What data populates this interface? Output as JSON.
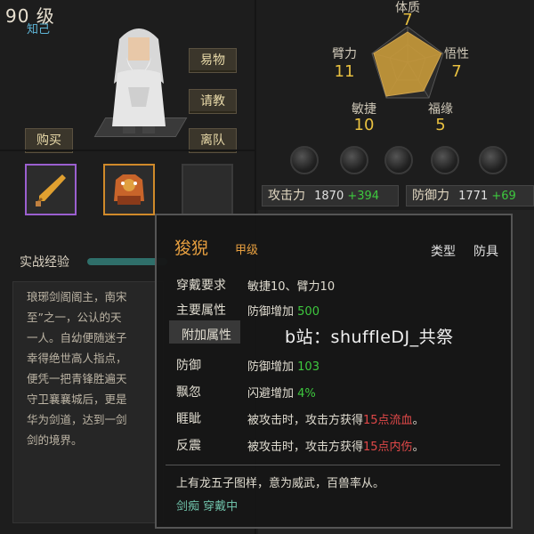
{
  "header": {
    "level": "90 级",
    "title_tag": "知己"
  },
  "actions": {
    "item": "易物",
    "consult": "请教",
    "leave": "离队",
    "buy": "购买"
  },
  "stats": {
    "tizhi": {
      "label": "体质",
      "value": "7"
    },
    "bili": {
      "label": "臂力",
      "value": "11"
    },
    "wuxing": {
      "label": "悟性",
      "value": "7"
    },
    "minjie": {
      "label": "敏捷",
      "value": "10"
    },
    "fuyuan": {
      "label": "福缘",
      "value": "5"
    }
  },
  "combat": {
    "attack_label": "攻击力",
    "attack_value": "1870",
    "attack_bonus": "+394",
    "defense_label": "防御力",
    "defense_value": "1771",
    "defense_bonus": "+69"
  },
  "experience": {
    "label": "实战经验"
  },
  "bio": {
    "lines": [
      "琅琊剑阁阁主，南宋",
      "至”之一，公认的天",
      "一人。自幼便随迷子",
      "幸得绝世高人指点，",
      "便凭一把青锋胜遍天",
      "守卫襄襄城后，更是",
      "华为剑道，达到一剑",
      "剑的境界。"
    ]
  },
  "tooltip": {
    "name": "狻猊",
    "grade": "甲级",
    "type_header": "类型",
    "type_value": "防具",
    "rows": [
      {
        "key": "穿戴要求",
        "value": "敏捷10、臂力10"
      },
      {
        "key": "主要属性",
        "value": "防御增加",
        "num": "500"
      },
      {
        "key": "附加属性",
        "value": ""
      },
      {
        "key": "防御",
        "value": "防御增加",
        "num": "103"
      },
      {
        "key": "飘忽",
        "value": "闪避增加",
        "num": "4%"
      },
      {
        "key": "睚眦",
        "value": "被攻击时，攻击方获得",
        "red": "15点流血",
        "end": "。"
      },
      {
        "key": "反震",
        "value": "被攻击时，攻击方获得",
        "red": "15点内伤",
        "end": "。"
      }
    ],
    "description": "上有龙五子图样，意为威武，百兽率从。",
    "status": "剑痴 穿戴中"
  },
  "watermark": "b站：shuffleDJ_共祭",
  "colors": {
    "accent_gold": "#e8c040",
    "bonus_green": "#3ec83e",
    "weapon_rarity": "#9b5fd0",
    "armor_rarity": "#d08a2a"
  }
}
